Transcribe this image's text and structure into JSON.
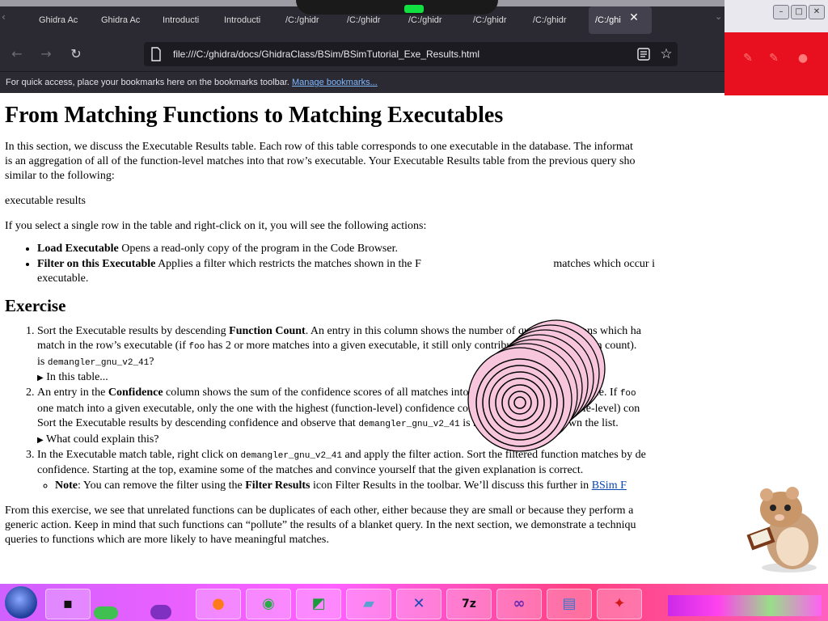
{
  "browser": {
    "tabs": [
      {
        "label": "Ghidra Ac"
      },
      {
        "label": "Ghidra Ac"
      },
      {
        "label": "Introducti"
      },
      {
        "label": "Introducti"
      },
      {
        "label": "/C:/ghidr"
      },
      {
        "label": "/C:/ghidr"
      },
      {
        "label": "/C:/ghidr"
      },
      {
        "label": "/C:/ghidr"
      },
      {
        "label": "/C:/ghidr"
      },
      {
        "label": "/C:/ghi",
        "active": true
      }
    ],
    "url": "file:///C:/ghidra/docs/GhidraClass/BSim/BSimTutorial_Exe_Results.html",
    "bookmarks_message": "For quick access, place your bookmarks here on the bookmarks toolbar.",
    "bookmarks_link": "Manage bookmarks..."
  },
  "page": {
    "title": "From Matching Functions to Matching Executables",
    "intro_line1": "In this section, we discuss the Executable Results table. Each row of this table corresponds to one executable in the database. The informat",
    "intro_line2": "is an aggregation of all of the function-level matches into that row’s executable. Your Executable Results table from the previous query sho",
    "intro_line3": "similar to the following:",
    "image_alt": "executable results",
    "actions_intro": "If you select a single row in the table and right-click on it, you will see the following actions:",
    "actions": [
      {
        "name": "Load Executable",
        "desc": " Opens a read-only copy of the program in the Code Browser."
      },
      {
        "name": "Filter on this Executable",
        "desc_line1": " Applies a filter which restricts the matches shown in the F",
        "desc_line1b": " matches which occur i",
        "desc_line2": "executable."
      }
    ],
    "exercise_heading": "Exercise",
    "ex1": {
      "a": "Sort the Executable results by descending ",
      "b": "Function Count",
      "c": ". An entry in this column shows the number of queried functions which ha",
      "d": "match in the row’s executable (if ",
      "e": "foo",
      "f": " has 2 or more matches into a given executable, it still only contributes 1 to the function count).",
      "g": "is ",
      "h": "demangler_gnu_v2_41",
      "i": "?",
      "disclosure": "In this table..."
    },
    "ex2": {
      "a": "An entry in the ",
      "b": "Confidence",
      "c": " column shows the sum of the confidence scores of all matches into the corresponding executable. If ",
      "d": "foo",
      "e": "one match into a given executable, only the one with the highest (function-level) confidence contributes to the (executable-level) con",
      "f": "Sort the Executable results by descending confidence and observe that ",
      "g": "demangler_gnu_v2_41",
      "h": " is now much further down the list.",
      "disclosure": "What could explain this?"
    },
    "ex3": {
      "a": "In the Executable match table, right click on ",
      "b": "demangler_gnu_v2_41",
      "c": " and apply the filter action. Sort the filtered function matches by de",
      "d": "confidence. Starting at the top, examine some of the matches and convince yourself that the given explanation is correct.",
      "note_label": "Note",
      "note_a": ": You can remove the filter using the ",
      "note_b": "Filter Results",
      "note_c": " icon Filter Results in the toolbar. We’ll discuss this further in ",
      "note_link": "BSim F"
    },
    "outro_line1": "From this exercise, we see that unrelated functions can be duplicates of each other, either because they are small or because they perform a",
    "outro_line2": "generic action. Keep in mind that such functions can “pollute” the results of a blanket query. In the next section, we demonstrate a techniqu",
    "outro_line3": "queries to functions which are more likely to have meaningful matches."
  },
  "colors": {
    "chrome_dark": "#2b2a33",
    "url_field": "#1c1b22",
    "link": "#0645ad",
    "right_banner_red": "#e8101e"
  }
}
